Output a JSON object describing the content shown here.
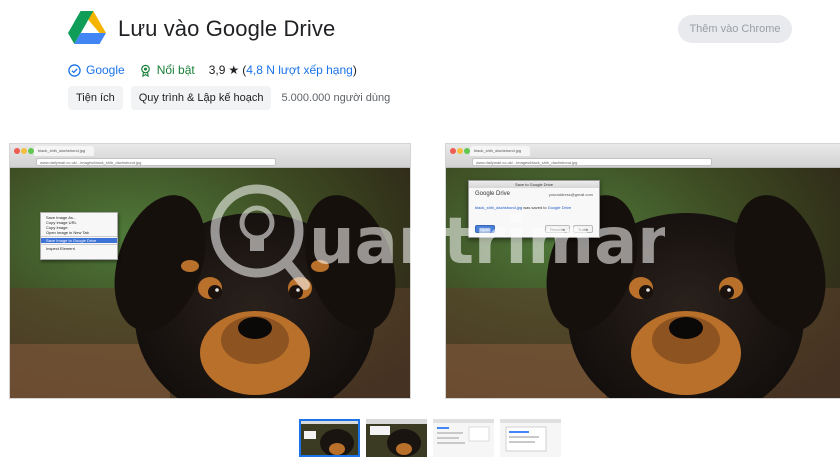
{
  "extension": {
    "title": "Lưu vào Google Drive",
    "add_button": "Thêm vào Chrome",
    "publisher": "Google",
    "featured": "Nổi bật",
    "rating": "3,9",
    "ratings_count": "4,8 N lượt xếp hạng",
    "categories": [
      "Tiện ích",
      "Quy trình & Lập kế hoạch"
    ],
    "users": "5.000.000 người dùng"
  },
  "screenshot1": {
    "tab_title": "black_shih_dachshund.jpg",
    "url": "www.dailymail.co.uk/...images/black_shih_dachshund.jpg",
    "menu_items": [
      "Save Image As...",
      "Copy Image URL",
      "Copy Image",
      "Open Image in New Tab"
    ],
    "menu_selected": "Save Image to Google Drive",
    "menu_inspect": "Inspect Element"
  },
  "screenshot2": {
    "tab_title": "black_shih_dachshund.jpg",
    "url": "www.dailymail.co.uk/...images/black_shih_dachshund.jpg",
    "dialog_title": "Save to Google Drive",
    "dialog_heading": "Google Drive",
    "dialog_email": "youraddress@gmail.com",
    "dialog_file": "black_shih_dachshund.jpg",
    "dialog_message": " was saved to ",
    "dialog_link": "Google Drive",
    "btn_open": "Open",
    "btn_rename": "Rename",
    "btn_trash": "Trash"
  },
  "watermark": {
    "text": "uantrimang"
  },
  "colors": {
    "accent": "#1a73e8",
    "featured_green": "#188038",
    "drive_green": "#0f9d58",
    "drive_yellow": "#f4b400",
    "drive_blue": "#4285f4"
  },
  "icons": {
    "logo": "google-drive-logo",
    "publisher": "verified-check-icon",
    "featured": "award-badge-icon",
    "rating": "star-icon"
  }
}
